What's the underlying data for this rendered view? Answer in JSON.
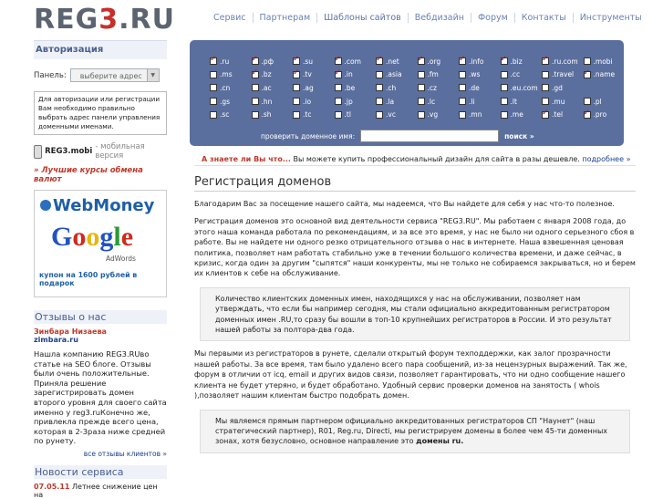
{
  "header": {
    "logo_part1": "REG",
    "logo_part2": "3",
    "logo_part3": ".RU",
    "nav": [
      "Сервис",
      "Партнерам",
      "Шаблоны сайтов",
      "Вебдизайн",
      "Форум",
      "Контакты",
      "Инструменты"
    ]
  },
  "sidebar": {
    "auth_title": "Авторизация",
    "panel_label": "Панель:",
    "panel_placeholder": "выберите адрес",
    "auth_note": "Для авторизации или регистрации Вам необходимо правильно выбрать адрес панели управления доменными именами.",
    "mobi_bold": "REG3.mobi",
    "mobi_rest": " - мобильная версия",
    "courses": "» Лучшие курсы обмена валют",
    "banner": {
      "webmoney": "WebMoney",
      "google": [
        "G",
        "o",
        "o",
        "g",
        "l",
        "e"
      ],
      "adwords": "AdWords",
      "coupon": "купон на 1600 рублей в подарок"
    },
    "reviews_title": "Отзывы о нас",
    "review_name": "Зинбарa Низаева",
    "review_link": "zimbara.ru",
    "review_text": "Нашла компанию    REG3.RUво статье на SEO блоге. Отзывы были очень положительные. Приняла решение зарегистрировать домен второго уровня для своего сайта именно у    reg3.ruКонечно же, привлекла прежде всего цена, которая в 2-3раза ниже средней по рунету.",
    "all_reviews": "все отзывы клиентов »",
    "news_title": "Новости сервиса",
    "news_date": "07.05.11",
    "news_text": " Летнее снижение цен на"
  },
  "domains": {
    "zones": [
      {
        "z": ".ru",
        "on": true
      },
      {
        "z": ".рф",
        "on": true
      },
      {
        "z": ".su",
        "on": true
      },
      {
        "z": ".com",
        "on": true
      },
      {
        "z": ".net",
        "on": true
      },
      {
        "z": ".org",
        "on": true
      },
      {
        "z": ".info",
        "on": true
      },
      {
        "z": ".biz",
        "on": true
      },
      {
        "z": ".ru.com",
        "on": true
      },
      {
        "z": ".mobi",
        "on": false
      },
      {
        "z": ".ms",
        "on": false
      },
      {
        "z": ".bz",
        "on": true
      },
      {
        "z": ".tv",
        "on": true
      },
      {
        "z": ".in",
        "on": true
      },
      {
        "z": ".asia",
        "on": false
      },
      {
        "z": ".fm",
        "on": false
      },
      {
        "z": ".ws",
        "on": false
      },
      {
        "z": ".cc",
        "on": false
      },
      {
        "z": ".travel",
        "on": false
      },
      {
        "z": ".name",
        "on": true
      },
      {
        "z": ".cn",
        "on": false
      },
      {
        "z": ".ac",
        "on": false
      },
      {
        "z": ".ag",
        "on": false
      },
      {
        "z": ".be",
        "on": false
      },
      {
        "z": ".ch",
        "on": false
      },
      {
        "z": ".cz",
        "on": false
      },
      {
        "z": ".de",
        "on": false
      },
      {
        "z": ".eu.com",
        "on": false
      },
      {
        "z": ".gd",
        "on": false
      },
      {
        "z": ".gs",
        "on": false
      },
      {
        "z": ".hn",
        "on": false
      },
      {
        "z": ".io",
        "on": false
      },
      {
        "z": ".jp",
        "on": false
      },
      {
        "z": ".la",
        "on": false
      },
      {
        "z": ".lc",
        "on": false
      },
      {
        "z": ".li",
        "on": false
      },
      {
        "z": ".lt",
        "on": false
      },
      {
        "z": ".mu",
        "on": false
      },
      {
        "z": ".pl",
        "on": false
      },
      {
        "z": ".sc",
        "on": false
      },
      {
        "z": ".sh",
        "on": false
      },
      {
        "z": ".tc",
        "on": false
      },
      {
        "z": ".tl",
        "on": false
      },
      {
        "z": ".vc",
        "on": false
      },
      {
        "z": ".vg",
        "on": false
      },
      {
        "z": ".mn",
        "on": false
      },
      {
        "z": ".me",
        "on": false
      },
      {
        "z": ".tel",
        "on": true
      },
      {
        "z": ".pro",
        "on": true
      }
    ],
    "check_label": "проверить доменное имя:",
    "search_btn": "поиск »"
  },
  "main": {
    "tip_q": "А знаете ли Вы что...",
    "tip_text": " Вы можете купить профессиональный дизайн для сайта в разы дешевле. ",
    "tip_more": "подробнее »",
    "title": "Регистрация доменов",
    "p1": "Благодарим Вас за посещение нашего сайта, мы надеемся, что Вы найдете для себя у нас что-то полезное.",
    "p2": "Регистрация доменов это основной вид деятельности сервиса \"REG3.RU\". Мы работаем с января 2008 года, до этого наша команда работала по рекомендациям, и за все это время, у нас не было ни одного серьезного сбоя в работе. Вы не найдете ни одного резко отрицательного отзыва о нас в интернете. Наша взвешенная         ценовая политика, позволяет нам работать стабильно уже в течении большого количества времени, и даже сейчас, в кризис, когда один за другим \"сыпятся\" наши   конкуренты, мы не только не собираемся закрываться, но и берем их клиентов      к себе на обслуживание.",
    "quote1": "Количество клиентских доменных имен, находящихся у нас на обслуживании,   позволяет нам утверждать, что если бы например сегодня, мы стали официально     аккредитованным регистратором доменных имен .RU,то сразу бы вошли в топ-10   крупнейших регистраторов в России. И это результат нашей работы за полтора-два года.",
    "p3": "Мы первыми из регистраторов в рунете, сделали открытый форум       техподдержки, как залог прозрачности нашей работы. За все время, там    было удалено всего пара сообщений, из-за нецензурных выражений. Так же, форум      в отличии от  icq,  email и других видов связи, позволяет гарантировать, что       ни одно сообщение нашего клиента не будет утеряно, и будет обработано. Удобный     сервис проверки доменов на занятость (    whois ),позволяет нашим клиентам быстро подобрать домен.",
    "quote2": "Мы являемся прямым партнером официально аккредитованных регистраторов                      СП \"Наунет\" (наш стратегический партнер), R01, Reg.ru, Directi, мы регистрируем домены в более чем 45-ти доменных зонах, хотя безусловно, основное направление это ",
    "quote2_bold": "домены ru."
  }
}
